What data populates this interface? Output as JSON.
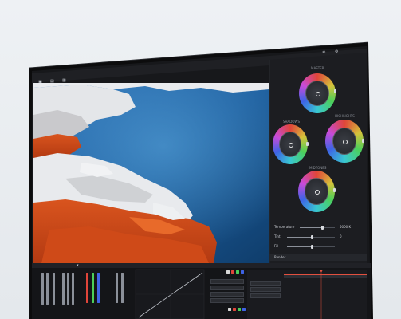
{
  "toolbar": {
    "left_items": [
      "",
      "",
      ""
    ],
    "center_label": "",
    "right_label": ""
  },
  "panel": {
    "wheels": {
      "master": {
        "label": "MASTER"
      },
      "shadows": {
        "label": "SHADOWS"
      },
      "highlights": {
        "label": "HIGHLIGHTS"
      },
      "midtones": {
        "label": "MIDTONES"
      }
    },
    "sliders": [
      {
        "label": "Temperature",
        "value": "5000 K",
        "level": 0.62
      },
      {
        "label": "Tint",
        "value": "0",
        "level": 0.5
      },
      {
        "label": "Fill",
        "value": "",
        "level": 0.5
      }
    ],
    "section_label": "Render"
  },
  "bottom": {
    "scopes_label": "",
    "rgb_colors": [
      "#e0453a",
      "#4ccf5a",
      "#3e63e6",
      "#d8d8d8"
    ]
  },
  "colors": {
    "app_bg": "#17181b",
    "panel_bg": "#1c1d21",
    "accent": "#e2503f"
  }
}
